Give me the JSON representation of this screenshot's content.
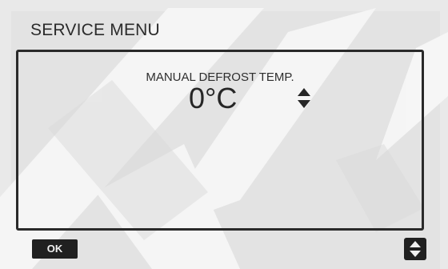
{
  "screen": {
    "title": "SERVICE MENU"
  },
  "setting": {
    "label": "MANUAL DEFROST TEMP.",
    "value": "0",
    "unit": "°C"
  },
  "footer": {
    "ok_label": "OK"
  },
  "icons": {
    "value_adjust": "up-down-arrows-icon",
    "scroll": "up-down-arrows-icon"
  },
  "colors": {
    "display_background": "#e3e3e3",
    "text": "#262626",
    "button": "#202020"
  }
}
